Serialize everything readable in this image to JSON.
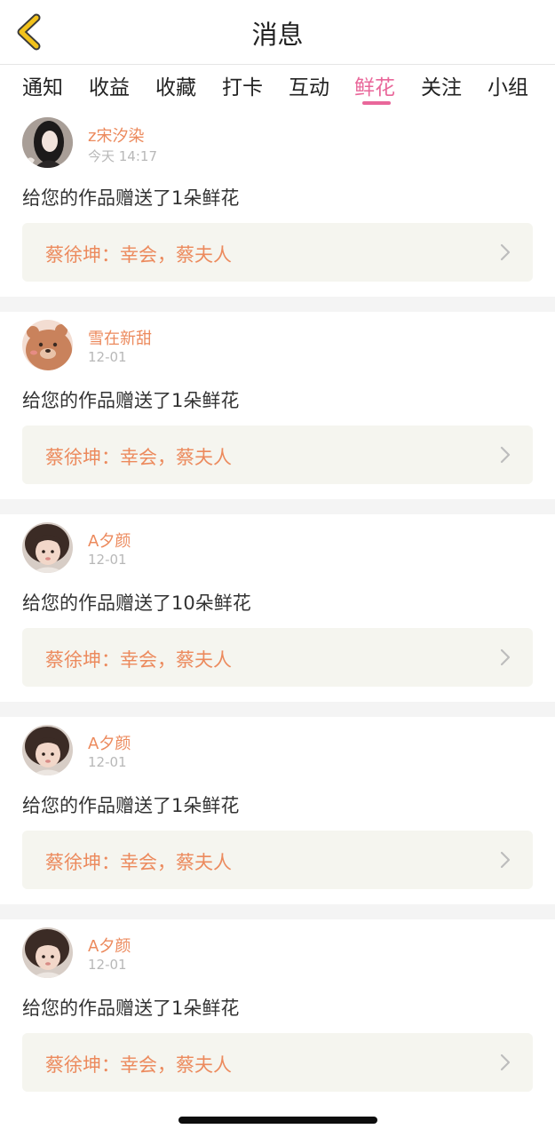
{
  "header": {
    "title": "消息",
    "back_icon": "chevron-left-icon",
    "back_color": "#f2c21b"
  },
  "tabs": [
    {
      "label": "通知",
      "active": false
    },
    {
      "label": "收益",
      "active": false
    },
    {
      "label": "收藏",
      "active": false
    },
    {
      "label": "打卡",
      "active": false
    },
    {
      "label": "互动",
      "active": false
    },
    {
      "label": "鲜花",
      "active": true
    },
    {
      "label": "关注",
      "active": false
    },
    {
      "label": "小组",
      "active": false
    }
  ],
  "colors": {
    "accent": "#e9679a",
    "username": "#ec8a5d",
    "work_box_bg": "#f5f5ef"
  },
  "messages": [
    {
      "user": "z宋汐染",
      "time": "今天 14:17",
      "text": "给您的作品赠送了1朵鲜花",
      "work": "蔡徐坤：幸会，蔡夫人",
      "avatar": "girl-dark-photo"
    },
    {
      "user": "雪在新甜",
      "time": "12-01",
      "text": "给您的作品赠送了1朵鲜花",
      "work": "蔡徐坤：幸会，蔡夫人",
      "avatar": "bear-cartoon"
    },
    {
      "user": "A夕颜",
      "time": "12-01",
      "text": "给您的作品赠送了10朵鲜花",
      "work": "蔡徐坤：幸会，蔡夫人",
      "avatar": "child-photo"
    },
    {
      "user": "A夕颜",
      "time": "12-01",
      "text": "给您的作品赠送了1朵鲜花",
      "work": "蔡徐坤：幸会，蔡夫人",
      "avatar": "child-photo"
    },
    {
      "user": "A夕颜",
      "time": "12-01",
      "text": "给您的作品赠送了1朵鲜花",
      "work": "蔡徐坤：幸会，蔡夫人",
      "avatar": "child-photo"
    }
  ]
}
